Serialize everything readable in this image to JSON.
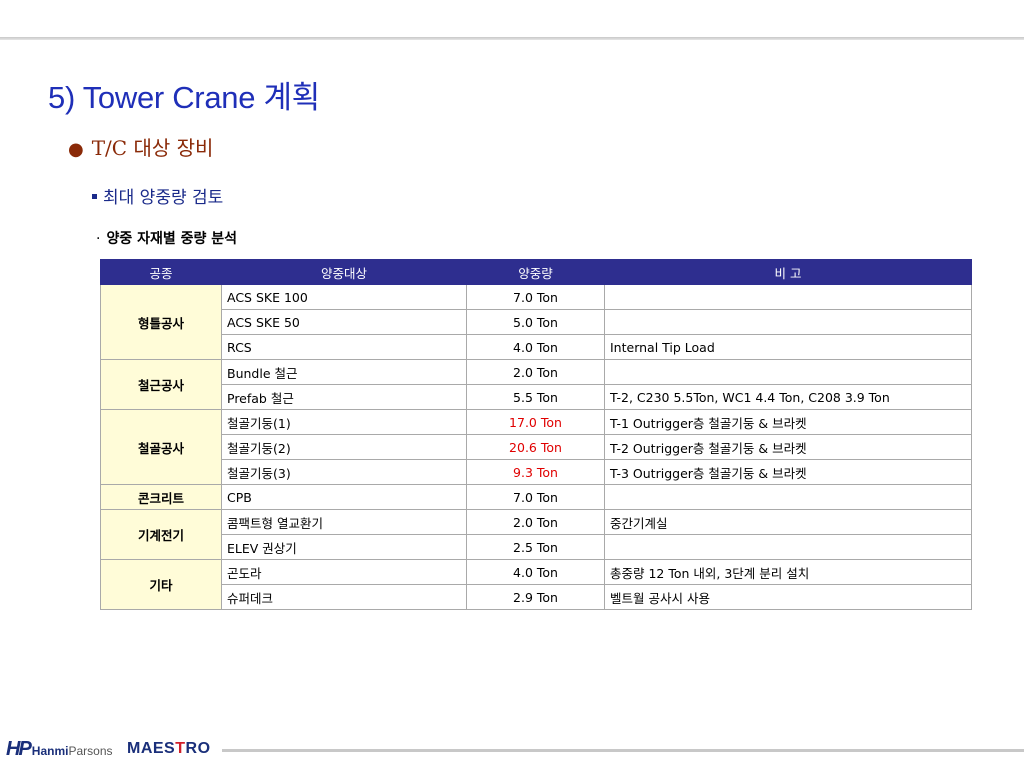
{
  "header": {
    "title": "5) Tower Crane 계획",
    "subtitle_bullet": "●",
    "subtitle": "T/C 대상 장비",
    "section": "최대 양중량 검토",
    "subsection_marker": "·",
    "subsection": "양중 자재별 중량 분석"
  },
  "table": {
    "headers": [
      "공종",
      "양중대상",
      "양중량",
      "비 고"
    ],
    "groups": [
      {
        "name": "형틀공사",
        "rows": [
          {
            "item": "ACS SKE 100",
            "weight": "7.0 Ton",
            "note": "",
            "highlight": false
          },
          {
            "item": "ACS SKE 50",
            "weight": "5.0 Ton",
            "note": "",
            "highlight": false
          },
          {
            "item": "RCS",
            "weight": "4.0 Ton",
            "note": "Internal Tip Load",
            "highlight": false
          }
        ]
      },
      {
        "name": "철근공사",
        "rows": [
          {
            "item": "Bundle 철근",
            "weight": "2.0 Ton",
            "note": "",
            "highlight": false
          },
          {
            "item": "Prefab 철근",
            "weight": "5.5 Ton",
            "note": "T-2, C230 5.5Ton, WC1 4.4 Ton, C208 3.9 Ton",
            "highlight": false
          }
        ]
      },
      {
        "name": "철골공사",
        "rows": [
          {
            "item": "철골기둥(1)",
            "weight": "17.0 Ton",
            "note": "T-1 Outrigger층 철골기둥 & 브라켓",
            "highlight": true
          },
          {
            "item": "철골기둥(2)",
            "weight": "20.6 Ton",
            "note": "T-2 Outrigger층 철골기둥 & 브라켓",
            "highlight": true
          },
          {
            "item": "철골기둥(3)",
            "weight": "9.3 Ton",
            "note": "T-3 Outrigger층 철골기둥 & 브라켓",
            "highlight": true
          }
        ]
      },
      {
        "name": "콘크리트",
        "rows": [
          {
            "item": "CPB",
            "weight": "7.0 Ton",
            "note": "",
            "highlight": false
          }
        ]
      },
      {
        "name": "기계전기",
        "rows": [
          {
            "item": "콤팩트형 열교환기",
            "weight": "2.0 Ton",
            "note": "중간기계실",
            "highlight": false
          },
          {
            "item": "ELEV 권상기",
            "weight": "2.5 Ton",
            "note": "",
            "highlight": false
          }
        ]
      },
      {
        "name": "기타",
        "rows": [
          {
            "item": "곤도라",
            "weight": "4.0 Ton",
            "note": "총중량 12 Ton 내외, 3단계 분리 설치",
            "highlight": false
          },
          {
            "item": "슈퍼데크",
            "weight": "2.9 Ton",
            "note": "벨트월 공사시 사용",
            "highlight": false
          }
        ]
      }
    ]
  },
  "footer": {
    "logo_hp": "HP",
    "logo_hanmi": "Hanmi",
    "logo_parsons": "Parsons",
    "logo_maestro_a": "MAES",
    "logo_maestro_b": "T",
    "logo_maestro_c": "RO"
  },
  "colors": {
    "title": "#1f2fb8",
    "subtitle": "#8a2a08",
    "header_bg": "#2e2e8f",
    "group_bg": "#fffcd8",
    "highlight": "#e00000"
  }
}
